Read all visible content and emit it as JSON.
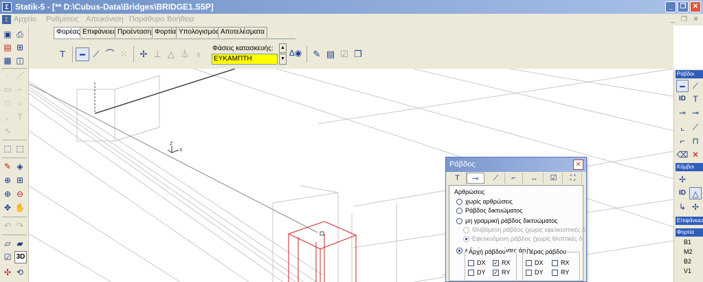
{
  "window": {
    "title": "Statik-5 - [** D:\\Cubus-Data\\Bridges\\BRIDGE1.S5P]"
  },
  "menu": [
    "Αρχείο",
    "Ρυθμίσεις",
    "Απεικόνιση",
    "Παράθυρο",
    "Βοήθεια"
  ],
  "tabs": [
    {
      "label": "Φορέας",
      "active": true
    },
    {
      "label": "Επιφάνειες",
      "active": false
    },
    {
      "label": "Προένταση",
      "active": false
    },
    {
      "label": "Φορτία",
      "active": false
    },
    {
      "label": "Υπολογισμός",
      "active": false
    },
    {
      "label": "Αποτελέσματα",
      "active": false
    }
  ],
  "phase": {
    "label": "Φάσεις κατασκευής:",
    "value": "ΕΥΚΑΜΠΤΗ"
  },
  "left_toolbar": {
    "btn_3d": "3D"
  },
  "right_toolbar": {
    "header_bars": "Ράβδοι",
    "header_nodes": "Κόμβοι",
    "header_surfaces": "Επιφάνειες",
    "header_loads": "Φορτία",
    "id_label": "ID",
    "load_cases": [
      "B1",
      "M2",
      "B2",
      "V1"
    ]
  },
  "canvas": {
    "axis_z": "Z",
    "axis_x": "X"
  },
  "dialog": {
    "title": "Ράβδος",
    "group_label": "Αρθρώσεις",
    "options": [
      {
        "label": "χωρίς αρθρώσεις",
        "checked": false,
        "disabled": false
      },
      {
        "label": "Ράβδος δικτυώματος",
        "checked": false,
        "disabled": false
      },
      {
        "label": "μη γραμμική ράβδος δικτυώματος",
        "checked": false,
        "disabled": false
      },
      {
        "label": "Θλιβόμενη ράβδος (χωρίς εφελκυστικές δ",
        "checked": false,
        "disabled": true
      },
      {
        "label": "Εφελκυόμενη ράβδος (χωρίς θλιπτικές δι",
        "checked": true,
        "disabled": true
      },
      {
        "label": "ειδικές συνιστώσες άρθρωσης",
        "checked": true,
        "disabled": false
      }
    ],
    "start_label": "Αρχή ράβδου",
    "end_label": "Πέρας ράβδου",
    "start_checks": [
      {
        "label": "DX",
        "checked": false
      },
      {
        "label": "RX",
        "checked": true
      },
      {
        "label": "DY",
        "checked": false
      },
      {
        "label": "RY",
        "checked": true
      }
    ],
    "end_checks": [
      {
        "label": "DX",
        "checked": false
      },
      {
        "label": "RX",
        "checked": false
      },
      {
        "label": "DY",
        "checked": false
      },
      {
        "label": "RY",
        "checked": false
      }
    ]
  }
}
